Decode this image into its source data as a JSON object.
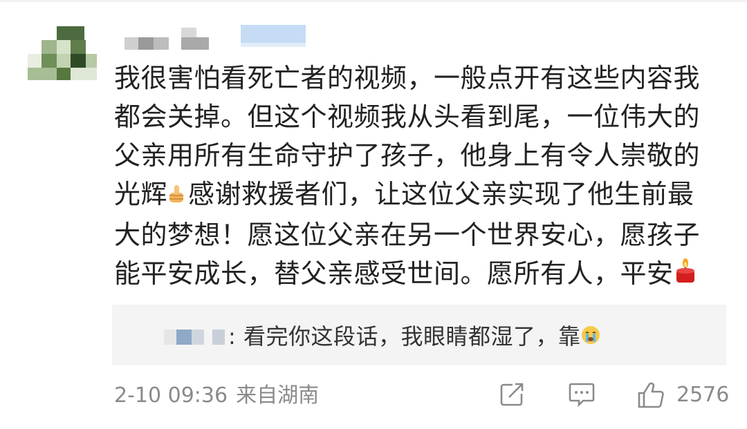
{
  "comment": {
    "text": "我很害怕看死亡者的视频，一般点开有这些内容我都会关掉。但这个视频我从头看到尾，一位伟大的父亲用所有生命守护了孩子，他身上有令人崇敬的光辉",
    "text_2": "感谢救援者们，让这位父亲实现了他生前最大的梦想！愿这位父亲在另一个世界安心，愿孩子能平安成长，替父亲感受世间。愿所有人，平安",
    "emoji_1": "thumbs-up-icon",
    "emoji_2": "red-candle-icon"
  },
  "reply": {
    "text": ": 看完你这段话，我眼睛都湿了，靠",
    "emoji": "crying-face-icon"
  },
  "footer": {
    "date": "2-10 09:36",
    "location": "来自湖南",
    "like_count": "2576"
  },
  "colors": {
    "text": "#222222",
    "meta": "#8a8a8a",
    "reply_bg": "#f4f4f4"
  }
}
